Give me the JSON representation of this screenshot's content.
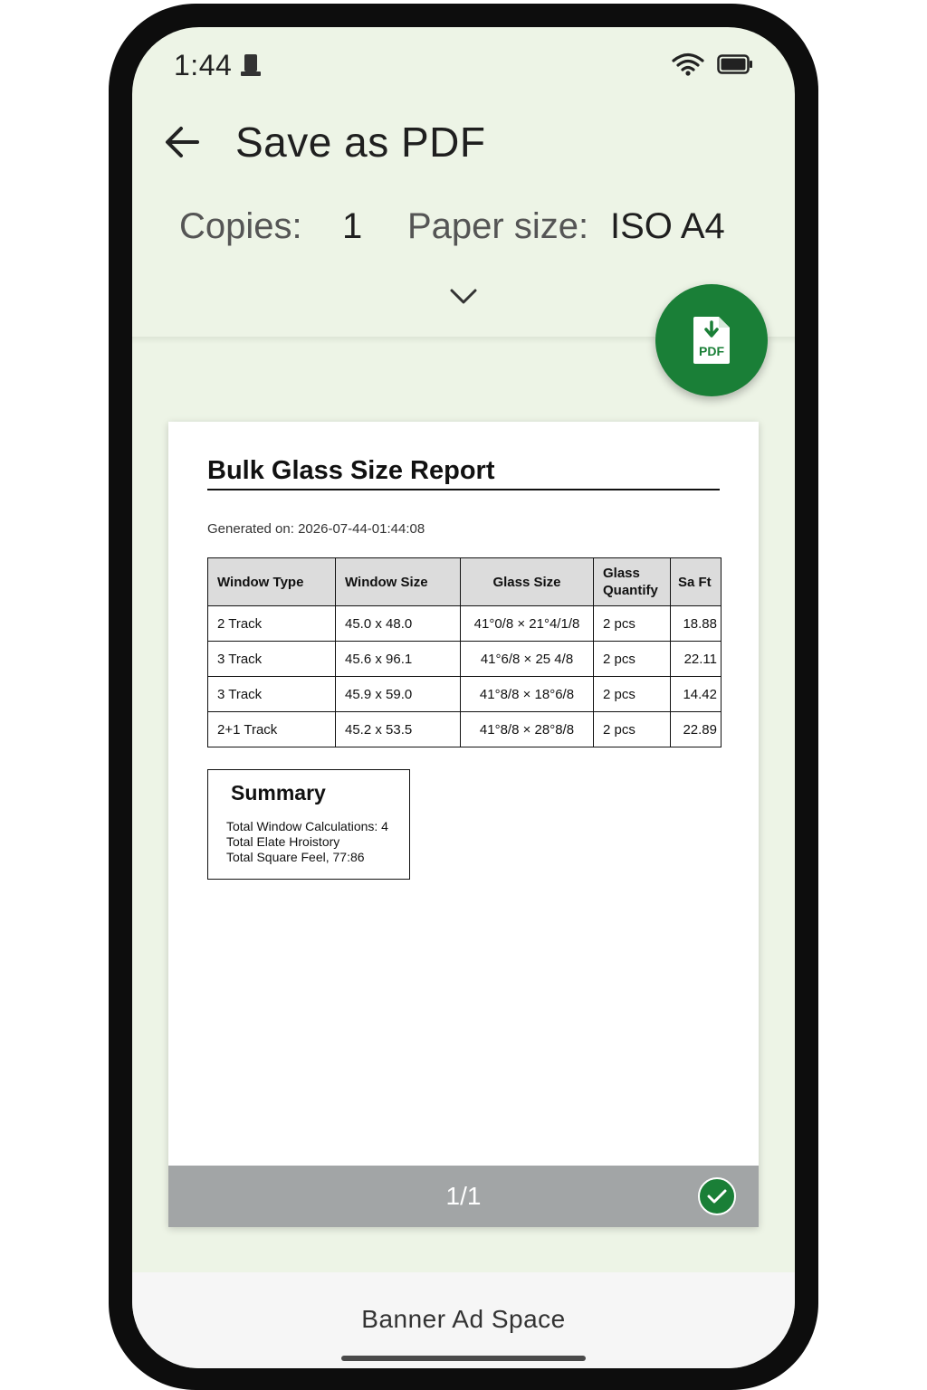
{
  "status_bar": {
    "time": "1:44"
  },
  "header": {
    "title": "Save as PDF",
    "copies_label": "Copies:",
    "copies_value": "1",
    "paper_size_label": "Paper size:",
    "paper_size_value": "ISO A4"
  },
  "fab": {
    "label": "PDF",
    "icon": "pdf-download-icon",
    "color": "#1a7f37"
  },
  "document": {
    "title": "Bulk Glass Size Report",
    "generated_label": "Generated",
    "generated_value": " on: 2026-07-44-01:44:08",
    "table": {
      "headers": [
        "Window Type",
        "Window Size",
        "Glass Size",
        "Glass Quantify",
        "Sa Ft"
      ],
      "rows": [
        [
          "2 Track",
          "45.0 x 48.0",
          "41°0/8  × 21°4/1/8",
          "2 pcs",
          "18.88"
        ],
        [
          "3 Track",
          "45.6 x 96.1",
          "41°6/8 × 25 4/8",
          "2 pcs",
          "22.11"
        ],
        [
          "3 Track",
          "45.9 x 59.0",
          "41°8/8 × 18°6/8",
          "2 pcs",
          "14.42"
        ],
        [
          "2+1 Track",
          "45.2 x 53.5",
          "41°8/8 × 28°8/8",
          "2 pcs",
          "22.89"
        ]
      ]
    },
    "summary": {
      "title": "Summary",
      "lines": [
        "Total Window Calculations: 4",
        "Total Elate Hroistory",
        "Total Square Feel, 77:86"
      ]
    },
    "page_indicator": "1/1"
  },
  "banner": {
    "text": "Banner Ad Space"
  },
  "colors": {
    "background": "#edf4e6",
    "accent": "#1a7f37",
    "footer": "#a2a5a6"
  }
}
